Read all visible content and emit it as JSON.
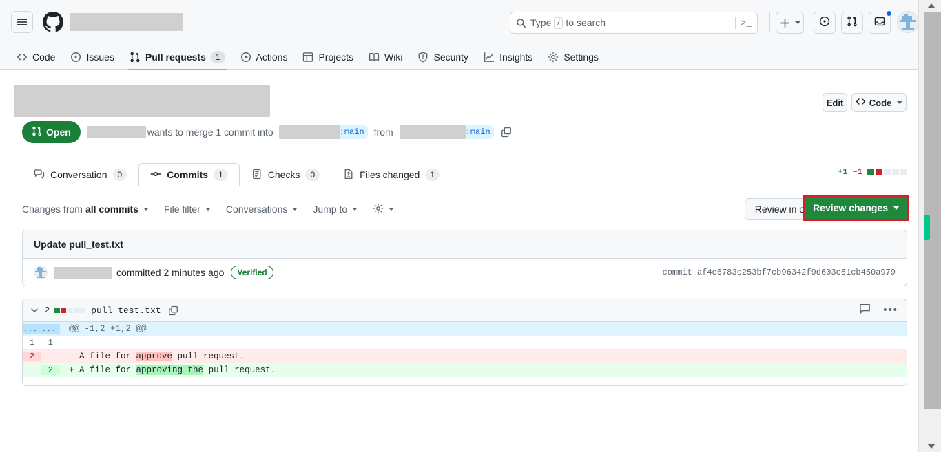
{
  "header": {
    "menu_icon": "hamburger-icon",
    "logo_icon": "github-logo-icon",
    "owner_redacted": true,
    "search": {
      "placeholder": "Type  to search",
      "key_hint": "/",
      "icon": "search-icon",
      "terminal_icon": ">_"
    },
    "actions": {
      "create_label": "+",
      "issues_icon": "issue-opened-icon",
      "pull_requests_icon": "git-pull-request-icon",
      "inbox_icon": "inbox-icon",
      "avatar_icon": "user-avatar"
    }
  },
  "repo_nav": {
    "items": [
      {
        "label": "Code",
        "icon": "code-icon",
        "count": "",
        "active": false
      },
      {
        "label": "Issues",
        "icon": "issue-opened-icon",
        "count": "",
        "active": false
      },
      {
        "label": "Pull requests",
        "icon": "git-pull-request-icon",
        "count": "1",
        "active": true
      },
      {
        "label": "Actions",
        "icon": "play-icon",
        "count": "",
        "active": false
      },
      {
        "label": "Projects",
        "icon": "table-icon",
        "count": "",
        "active": false
      },
      {
        "label": "Wiki",
        "icon": "book-icon",
        "count": "",
        "active": false
      },
      {
        "label": "Security",
        "icon": "shield-icon",
        "count": "",
        "active": false
      },
      {
        "label": "Insights",
        "icon": "graph-icon",
        "count": "",
        "active": false
      },
      {
        "label": "Settings",
        "icon": "gear-icon",
        "count": "",
        "active": false
      }
    ]
  },
  "pr": {
    "title_redacted": true,
    "edit_label": "Edit",
    "code_label": "Code",
    "state": "Open",
    "state_icon": "git-pull-request-icon",
    "state_color": "#1a7f37",
    "merge_text_1": "wants to merge 1 commit into",
    "merge_text_2": "from",
    "base_branch": ":main",
    "head_branch": ":main",
    "copy_icon": "copy-icon"
  },
  "tabs": [
    {
      "label": "Conversation",
      "icon": "comment-discussion-icon",
      "count": "0",
      "active": false
    },
    {
      "label": "Commits",
      "icon": "git-commit-icon",
      "count": "1",
      "active": true
    },
    {
      "label": "Checks",
      "icon": "checklist-icon",
      "count": "0",
      "active": false
    },
    {
      "label": "Files changed",
      "icon": "file-diff-icon",
      "count": "1",
      "active": false
    }
  ],
  "diffstat": {
    "additions": "+1",
    "deletions": "−1",
    "blocks": [
      "g",
      "r",
      "n",
      "n",
      "n"
    ],
    "add_color": "#1a7f37",
    "del_color": "#cf222e"
  },
  "toolbar": {
    "changes_from_prefix": "Changes from",
    "changes_from_value": "all commits",
    "file_filter": "File filter",
    "conversations": "Conversations",
    "jump_to": "Jump to",
    "gear_icon": "gear-icon",
    "review_codespace": "Review in codespace",
    "review_changes": "Review changes",
    "review_changes_highlight_color": "#e01b24"
  },
  "commit": {
    "message": "Update pull_test.txt",
    "committer_redacted": true,
    "committed_text": "committed 2 minutes ago",
    "verified_badge": "Verified",
    "sha_label": "commit",
    "sha": "af4c6783c253bf7cb96342f9d603c61cb450a979"
  },
  "file": {
    "chevron_icon": "chevron-down-icon",
    "change_count": "2",
    "blocks": [
      "g",
      "r",
      "n",
      "n",
      "n"
    ],
    "filename": "pull_test.txt",
    "copy_icon": "copy-path-icon",
    "comment_icon": "comment-icon",
    "kebab_icon": "kebab-horizontal-icon",
    "diff_rows": [
      {
        "type": "hunk",
        "old": "...",
        "new": "...",
        "code": "@@ -1,2 +1,2 @@"
      },
      {
        "type": "ctx",
        "old": "1",
        "new": "1",
        "code": ""
      },
      {
        "type": "del",
        "old": "2",
        "new": "",
        "prefix": "- ",
        "pre": "A file for ",
        "hl": "approve",
        "post": " pull request."
      },
      {
        "type": "add",
        "old": "",
        "new": "2",
        "prefix": "+ ",
        "pre": "A file for ",
        "hl": "approving the",
        "post": " pull request."
      }
    ]
  },
  "scrollbar": {
    "marker_color": "#00c58e"
  }
}
